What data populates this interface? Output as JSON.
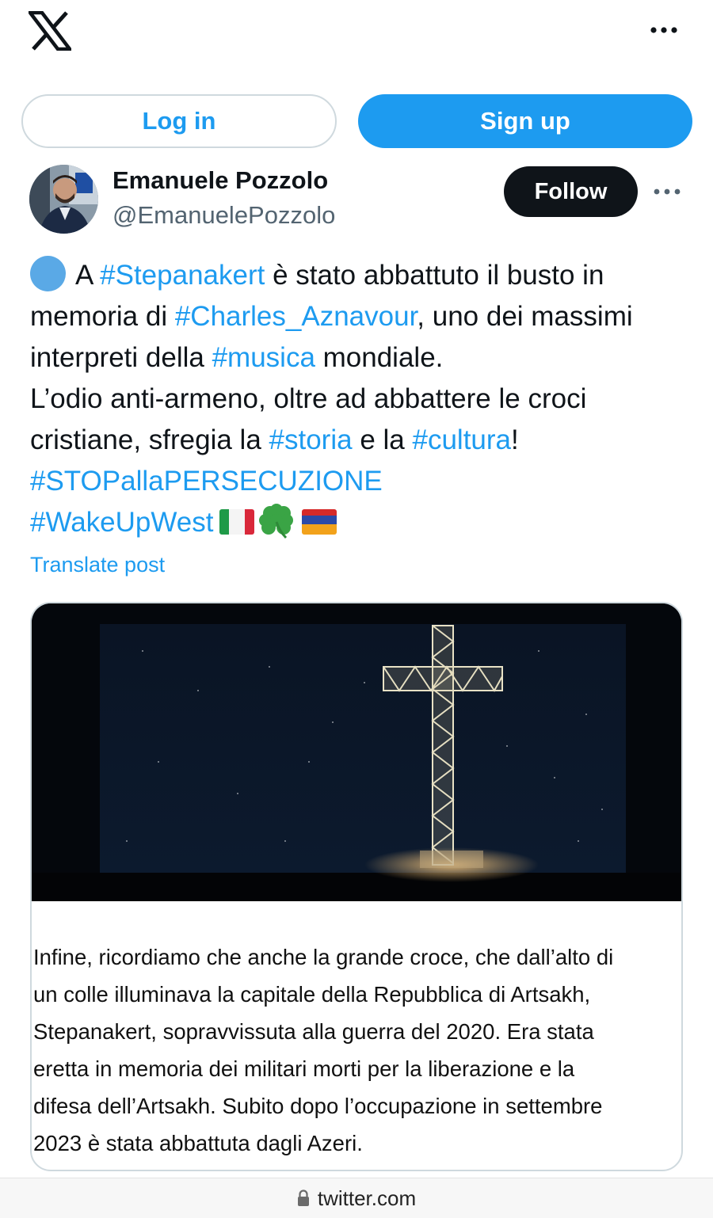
{
  "header": {
    "logo_icon": "x-logo-icon",
    "more_icon": "more-horizontal-icon"
  },
  "auth": {
    "login_label": "Log in",
    "signup_label": "Sign up"
  },
  "author": {
    "name": "Emanuele Pozzolo",
    "handle": "@EmanuelePozzolo",
    "follow_label": "Follow"
  },
  "tweet": {
    "l1_pre": "A ",
    "l1_tag": "#Stepanakert",
    "l1_post": " è stato abbattuto il busto in",
    "l2_pre": "memoria di ",
    "l2_tag": "#Charles_Aznavour",
    "l2_post": ", uno dei massimi",
    "l3_pre": "interpreti della ",
    "l3_tag": "#musica",
    "l3_post": " mondiale.",
    "l4": "L’odio anti-armeno, oltre ad abbattere le croci",
    "l5_pre": "cristiane, sfregia la ",
    "l5_tag1": "#storia",
    "l5_mid": " e la ",
    "l5_tag2": "#cultura",
    "l5_post": "!",
    "l6_tag": "#STOPallaPERSECUZIONE",
    "l7_tag": "#WakeUpWest",
    "emojis": [
      "flag-italy-icon",
      "four-leaf-clover-icon",
      "flag-armenia-icon"
    ]
  },
  "translate_label": "Translate post",
  "media": {
    "image_icon": "illuminated-cross-photo",
    "caption_lines": [
      "Infine, ricordiamo che anche la grande croce, che dall’alto di",
      "un colle illuminava la capitale della Repubblica di Artsakh,",
      "Stepanakert, sopravvissuta alla guerra del 2020. Era stata",
      "eretta in memoria dei militari morti per la liberazione e la",
      "difesa dell’Artsakh. Subito dopo l’occupazione in settembre",
      "2023 è stata abbattuta dagli Azeri."
    ]
  },
  "browser": {
    "lock_icon": "lock-icon",
    "url": "twitter.com"
  },
  "colors": {
    "accent": "#1d9bf0",
    "text": "#0f1419",
    "muted": "#536471",
    "follow_bg": "#0f1419"
  }
}
